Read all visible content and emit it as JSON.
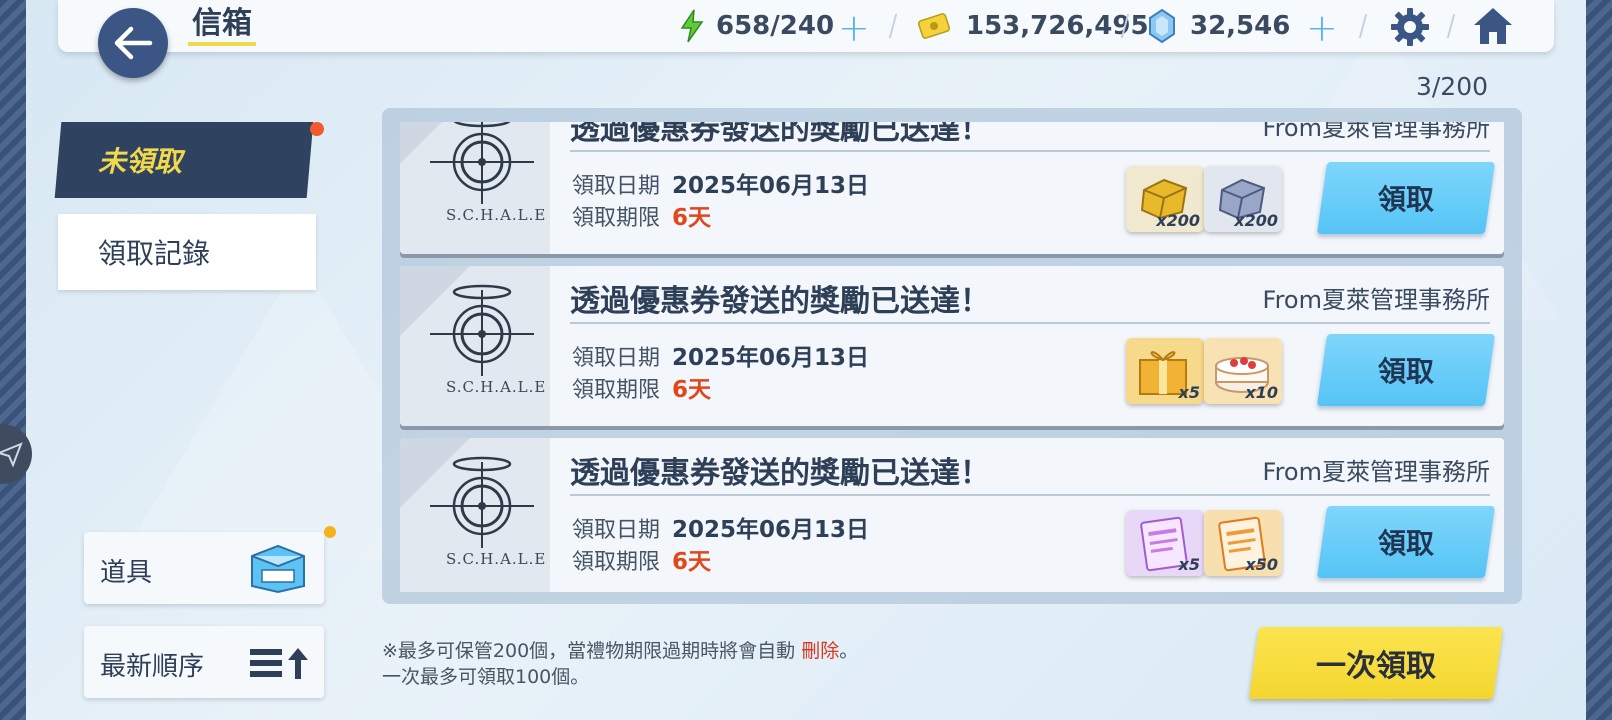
{
  "header": {
    "title": "信箱",
    "stamina": "658/240",
    "credits": "153,726,495",
    "pyroxene": "32,546"
  },
  "mailbox": {
    "count": "3/200",
    "tabs": [
      {
        "label": "未領取",
        "active": true,
        "has_notification": true
      },
      {
        "label": "領取記錄",
        "active": false
      }
    ],
    "items_button_label": "道具",
    "sort_button_label": "最新順序"
  },
  "mails": [
    {
      "title": "透過優惠券發送的獎勵已送達！",
      "from": "From夏萊管理事務所",
      "date_label": "領取日期",
      "date": "2025年06月13日",
      "expiry_label": "領取期限",
      "expiry": "6天",
      "sender_logo_text": "S.C.H.A.L.E",
      "rewards": [
        {
          "icon": "gold-ore-icon",
          "qty": "x200"
        },
        {
          "icon": "silver-ore-icon",
          "qty": "x200"
        }
      ],
      "claim_label": "領取"
    },
    {
      "title": "透過優惠券發送的獎勵已送達！",
      "from": "From夏萊管理事務所",
      "date_label": "領取日期",
      "date": "2025年06月13日",
      "expiry_label": "領取期限",
      "expiry": "6天",
      "sender_logo_text": "S.C.H.A.L.E",
      "rewards": [
        {
          "icon": "gift-box-icon",
          "qty": "x5"
        },
        {
          "icon": "cake-icon",
          "qty": "x10"
        }
      ],
      "claim_label": "領取"
    },
    {
      "title": "透過優惠券發送的獎勵已送達！",
      "from": "From夏萊管理事務所",
      "date_label": "領取日期",
      "date": "2025年06月13日",
      "expiry_label": "領取期限",
      "expiry": "6天",
      "sender_logo_text": "S.C.H.A.L.E",
      "rewards": [
        {
          "icon": "purple-report-icon",
          "qty": "x5"
        },
        {
          "icon": "orange-report-icon",
          "qty": "x50"
        }
      ],
      "claim_label": "領取"
    }
  ],
  "footer": {
    "note_line1_prefix": "※最多可保管200個，當禮物期限過期時將會自動",
    "note_line1_warn": "刪除",
    "note_line1_suffix": "。",
    "note_line2": "一次最多可領取100個。",
    "claim_all_label": "一次領取"
  },
  "colors": {
    "accent_dark": "#2f4360",
    "highlight_yellow": "#f2d84c",
    "claim_blue": "#55c4f6",
    "expiry_red": "#e0471a"
  }
}
